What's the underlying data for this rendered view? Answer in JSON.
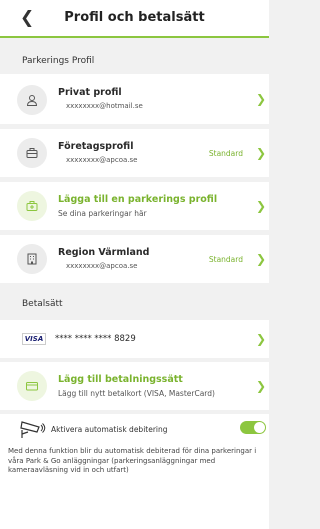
{
  "header": {
    "back_icon": "chevron-left",
    "title": "Profil och betalsätt"
  },
  "parking_section": {
    "heading": "Parkerings Profil"
  },
  "profiles": [
    {
      "icon": "person-icon",
      "title": "Privat profil",
      "subtitle": "xxxxxxxx@hotmail.se",
      "badge": ""
    },
    {
      "icon": "briefcase-icon",
      "title": "Företagsprofil",
      "subtitle": "xxxxxxxx@apcoa.se",
      "badge": "Standard"
    },
    {
      "icon": "briefcase-add-icon",
      "title": "Lägga till en parkerings profil",
      "subtitle": "Se dina parkeringar här",
      "badge": ""
    },
    {
      "icon": "building-icon",
      "title": "Region Värmland",
      "subtitle": "xxxxxxxx@apcoa.se",
      "badge": "Standard"
    }
  ],
  "payment_section": {
    "heading": "Betalsätt"
  },
  "card": {
    "brand": "VISA",
    "number": "**** **** **** 8829"
  },
  "add_payment": {
    "title": "Lägg till betalningssätt",
    "subtitle": "Lägg till nytt betalkort (VISA, MasterCard)"
  },
  "auto_debit": {
    "label": "Aktivera automatisk debitering",
    "enabled": true,
    "description": "Med denna funktion blir du automatisk debiterad för dina parkeringar i våra Park & Go anläggningar (parkeringsanläggningar med kameraavläsning vid in och utfart)"
  },
  "colors": {
    "accent": "#8cc63f",
    "accent_text": "#7ab32e",
    "background": "#f1f1f1"
  }
}
